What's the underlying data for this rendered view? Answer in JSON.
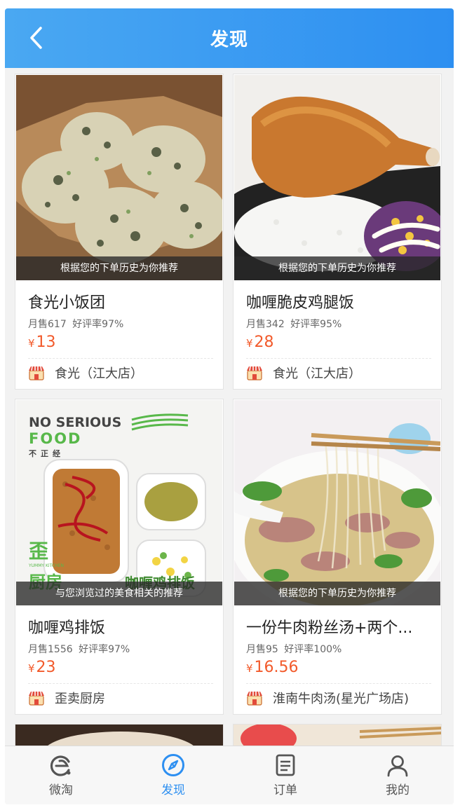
{
  "header": {
    "title": "发现"
  },
  "cards": [
    {
      "image": "rice-balls-photo",
      "reason": "根据您的下单历史为你推荐",
      "name": "食光小饭团",
      "sales": "月售617",
      "rating": "好评率97%",
      "currency": "¥",
      "price": "13",
      "shop": "食光（江大店）"
    },
    {
      "image": "fried-chicken-leg-rice-photo",
      "reason": "根据您的下单历史为你推荐",
      "name": "咖喱脆皮鸡腿饭",
      "sales": "月售342",
      "rating": "好评率95%",
      "currency": "¥",
      "price": "28",
      "shop": "食光（江大店）"
    },
    {
      "image": "curry-chicken-cutlet-photo",
      "reason": "与您浏览过的美食相关的推荐",
      "name": "咖喱鸡排饭",
      "sales": "月售1556",
      "rating": "好评率97%",
      "currency": "¥",
      "price": "23",
      "shop": "歪卖厨房",
      "poster": {
        "line1": "NO SERIOUS",
        "line2": "FOOD",
        "line3": "不正经",
        "brand1": "歪",
        "brand2": "厨房",
        "brand_small": "YUMMY KITCHEN",
        "overlay": "咖喱鸡排饭"
      }
    },
    {
      "image": "beef-vermicelli-soup-photo",
      "reason": "根据您的下单历史为你推荐",
      "name": "一份牛肉粉丝汤+两个...",
      "sales": "月售95",
      "rating": "好评率100%",
      "currency": "¥",
      "price": "16.56",
      "shop": "淮南牛肉汤(星光广场店)"
    }
  ],
  "tabbar": [
    {
      "label": "微淘",
      "icon": "weitao-icon",
      "active": false
    },
    {
      "label": "发现",
      "icon": "compass-icon",
      "active": true
    },
    {
      "label": "订单",
      "icon": "order-list-icon",
      "active": false
    },
    {
      "label": "我的",
      "icon": "user-icon",
      "active": false
    }
  ],
  "colors": {
    "header": "#2d8ff1",
    "price": "#f25a2b",
    "active_tab": "#2d8ff1"
  }
}
